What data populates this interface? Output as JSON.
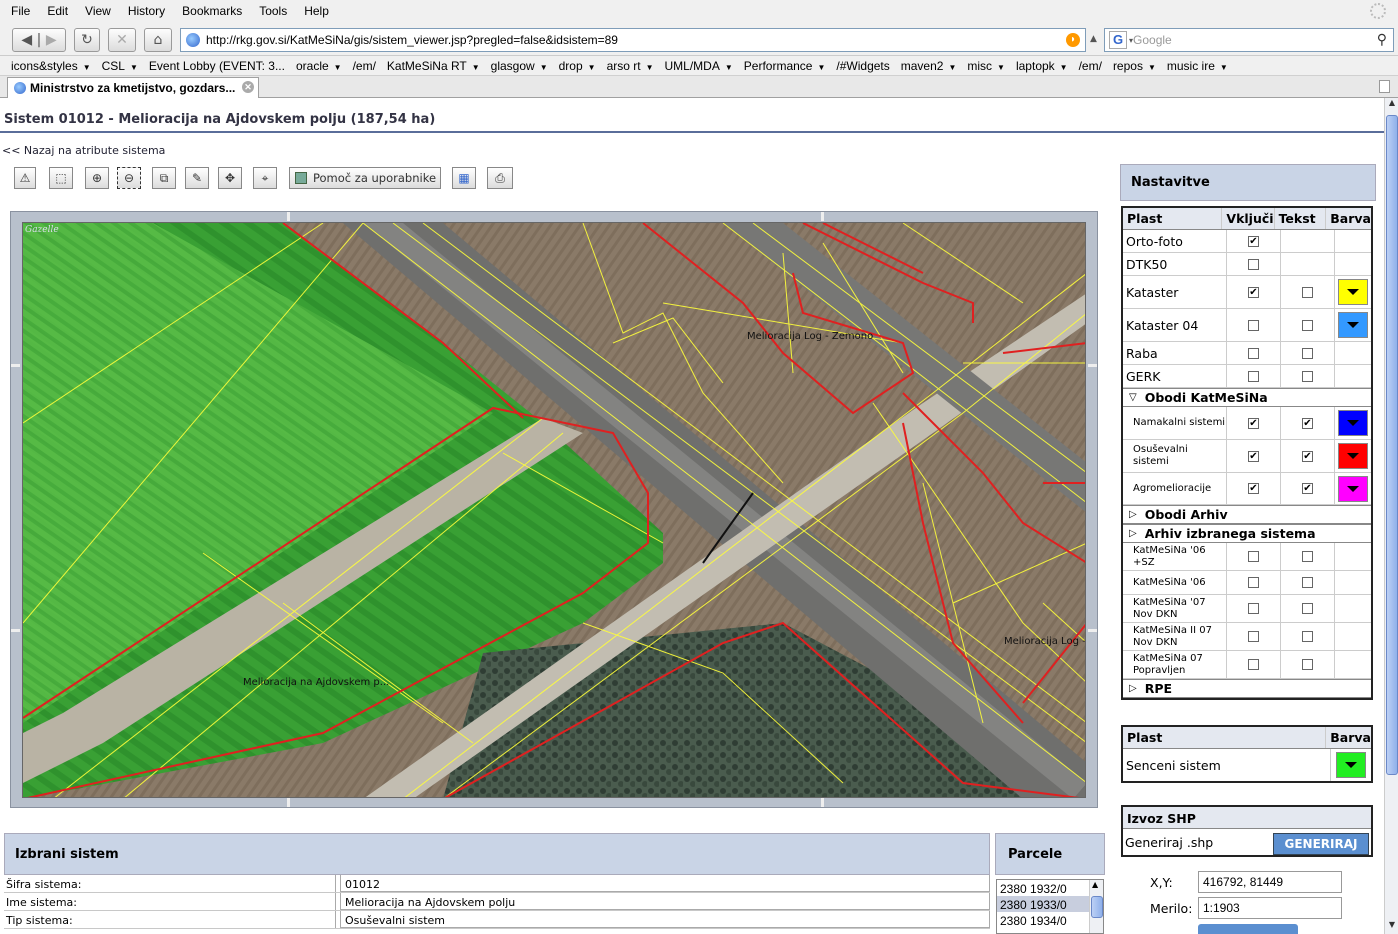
{
  "browser": {
    "menu": [
      {
        "label": "File"
      },
      {
        "label": "Edit"
      },
      {
        "label": "View"
      },
      {
        "label": "History"
      },
      {
        "label": "Bookmarks"
      },
      {
        "label": "Tools"
      },
      {
        "label": "Help"
      }
    ],
    "url": "http://rkg.gov.si/KatMeSiNa/gis/sistem_viewer.jsp?pregled=false&idsistem=89",
    "search_placeholder": "Google",
    "bookmarks": [
      {
        "label": "icons&styles",
        "dropdown": true
      },
      {
        "label": "CSL",
        "dropdown": true
      },
      {
        "label": "Event Lobby (EVENT: 3...",
        "dropdown": false
      },
      {
        "label": "oracle",
        "dropdown": true
      },
      {
        "label": "/em/",
        "dropdown": false
      },
      {
        "label": "KatMeSiNa RT",
        "dropdown": true
      },
      {
        "label": "glasgow",
        "dropdown": true
      },
      {
        "label": "drop",
        "dropdown": true
      },
      {
        "label": "arso rt",
        "dropdown": true
      },
      {
        "label": "UML/MDA",
        "dropdown": true
      },
      {
        "label": "Performance",
        "dropdown": true
      },
      {
        "label": "/#Widgets",
        "dropdown": false
      },
      {
        "label": "maven2",
        "dropdown": true
      },
      {
        "label": "misc",
        "dropdown": true
      },
      {
        "label": "laptopk",
        "dropdown": true
      },
      {
        "label": "/em/",
        "dropdown": false
      },
      {
        "label": "repos",
        "dropdown": true
      },
      {
        "label": "music ire",
        "dropdown": true
      }
    ],
    "tab_title": "Ministrstvo za kmetijstvo, gozdars..."
  },
  "page": {
    "title": "Sistem 01012 - Melioracija na Ajdovskem polju (187,54 ha)",
    "back_link": "<< Nazaj na atribute sistema",
    "toolbar_help": "Pomoč za uporabnike",
    "map": {
      "watermark": "Gazelle",
      "labels": [
        "Melioracija Log - Zemono",
        "Melioracija na  Ajdovskem p...",
        "Melioracija Log -"
      ]
    },
    "selected_system": {
      "header": "Izbrani sistem",
      "rows": [
        {
          "key": "Šifra sistema:",
          "value": "01012"
        },
        {
          "key": "Ime sistema:",
          "value": "Melioracija na Ajdovskem polju"
        },
        {
          "key": "Tip sistema:",
          "value": "Osuševalni sistem"
        }
      ]
    },
    "parcels": {
      "header": "Parcele",
      "items": [
        "2380 1932/0",
        "2380 1933/0",
        "2380 1934/0"
      ],
      "selected_index": 1
    },
    "settings": {
      "header": "Nastavitve",
      "columns": [
        "Plast",
        "Vključi",
        "Tekst",
        "Barva"
      ],
      "layers": [
        {
          "name": "Orto-foto",
          "on": true
        },
        {
          "name": "DTK50",
          "on": false
        },
        {
          "name": "Kataster",
          "on": true,
          "text": false,
          "color": "#ffff00"
        },
        {
          "name": "Kataster 04",
          "on": false,
          "text": false,
          "color": "#3399ff"
        },
        {
          "name": "Raba",
          "on": false,
          "text": false
        },
        {
          "name": "GERK",
          "on": false,
          "text": false
        }
      ],
      "group_obodi": "Obodi KatMeSiNa",
      "obodi": [
        {
          "name": "Namakalni sistemi",
          "on": true,
          "text": true,
          "color": "#0000ff"
        },
        {
          "name": "Osuševalni sistemi",
          "on": true,
          "text": true,
          "color": "#ff0000"
        },
        {
          "name": "Agromelioracije",
          "on": true,
          "text": true,
          "color": "#ff00ff"
        }
      ],
      "group_arhiv": "Obodi Arhiv",
      "group_arhiv_sistema": "Arhiv izbranega sistema",
      "arhiv": [
        {
          "name": "KatMeSiNa '06 +SZ",
          "on": false,
          "text": false
        },
        {
          "name": "KatMeSiNa '06",
          "on": false,
          "text": false
        },
        {
          "name": "KatMeSiNa '07 Nov DKN",
          "on": false,
          "text": false
        },
        {
          "name": "KatMeSiNa II 07 Nov DKN",
          "on": false,
          "text": false
        },
        {
          "name": "KatMeSiNa 07 Popravljen",
          "on": false,
          "text": false
        }
      ],
      "group_rpe": "RPE"
    },
    "shadow": {
      "columns": [
        "Plast",
        "Barva"
      ],
      "row": {
        "name": "Senceni sistem",
        "color": "#22ee22"
      }
    },
    "export": {
      "header": "Izvoz SHP",
      "label": "Generiraj .shp",
      "button": "GENERIRAJ"
    },
    "coords": {
      "label": "X,Y:",
      "value": "416792, 81449"
    },
    "scale": {
      "label": "Merilo:",
      "value": "1:1903"
    }
  }
}
